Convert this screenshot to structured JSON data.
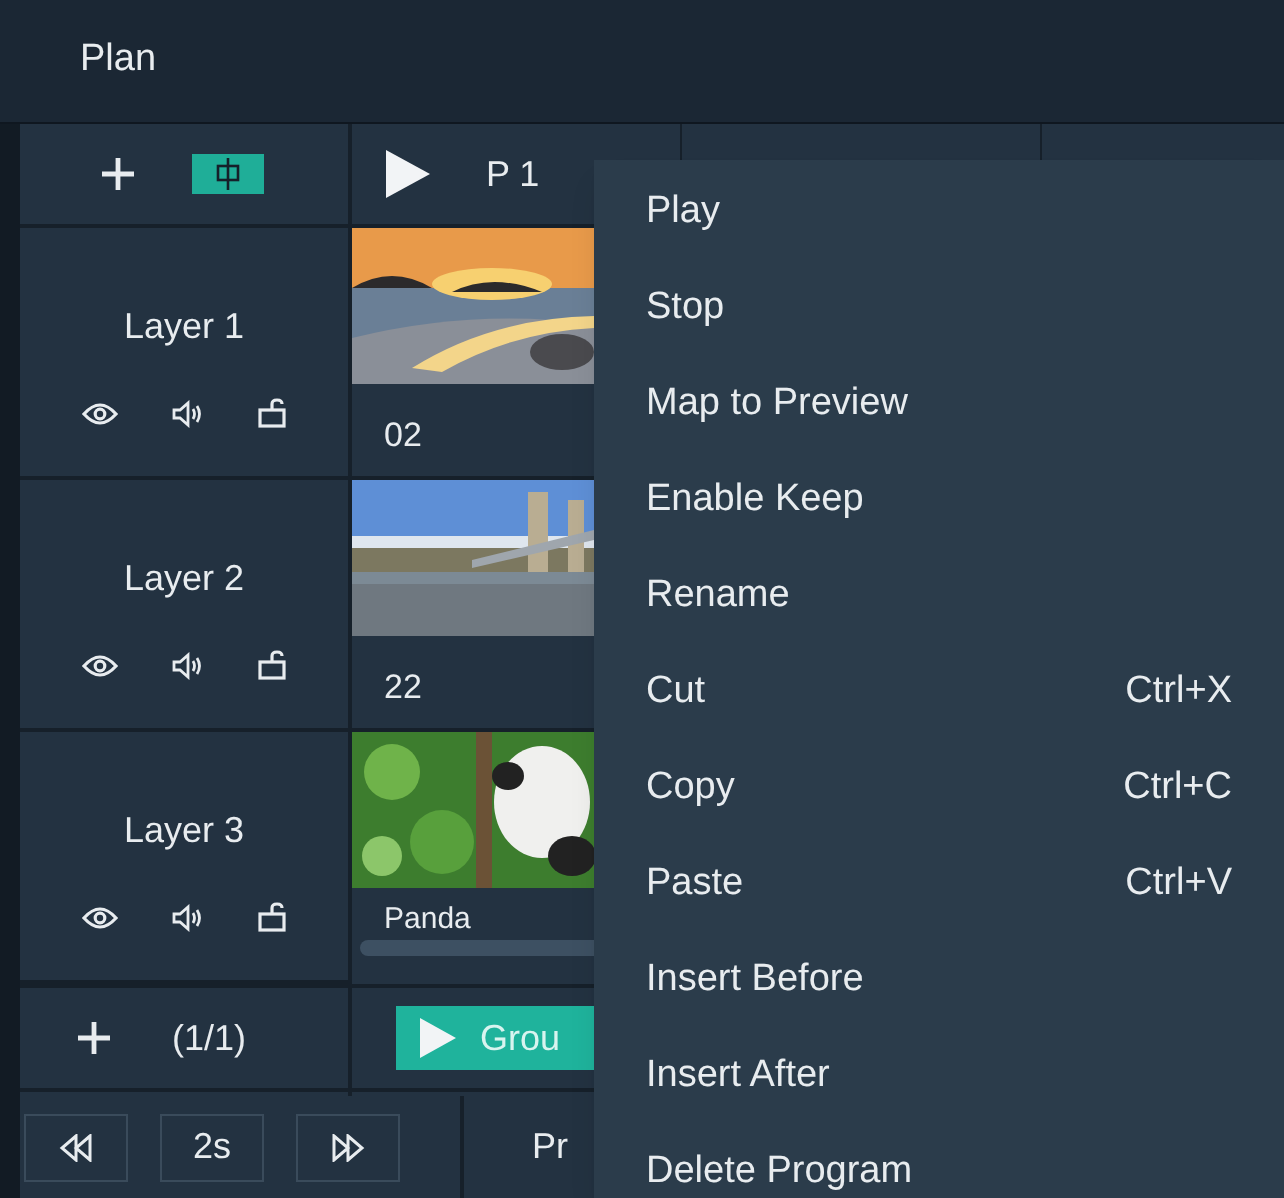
{
  "title": "Plan",
  "program_header": {
    "label": "P 1"
  },
  "layers": [
    {
      "name": "Layer 1",
      "thumbnail": {
        "kind": "picture",
        "label": "02"
      }
    },
    {
      "name": "Layer 2",
      "thumbnail": {
        "kind": "picture",
        "label": "22"
      }
    },
    {
      "name": "Layer 3",
      "thumbnail": {
        "kind": "picture",
        "label": "Panda"
      }
    }
  ],
  "layer_footer": {
    "page": "(1/1)"
  },
  "group_button": {
    "label": "Grou"
  },
  "transport": {
    "interval": "2s"
  },
  "program_label": "Pr",
  "context_menu": [
    {
      "label": "Play"
    },
    {
      "label": "Stop"
    },
    {
      "label": "Map to Preview"
    },
    {
      "label": "Enable Keep"
    },
    {
      "label": "Rename"
    },
    {
      "label": "Cut",
      "shortcut": "Ctrl+X"
    },
    {
      "label": "Copy",
      "shortcut": "Ctrl+C"
    },
    {
      "label": "Paste",
      "shortcut": "Ctrl+V"
    },
    {
      "label": "Insert Before"
    },
    {
      "label": "Insert After"
    },
    {
      "label": "Delete Program"
    }
  ]
}
